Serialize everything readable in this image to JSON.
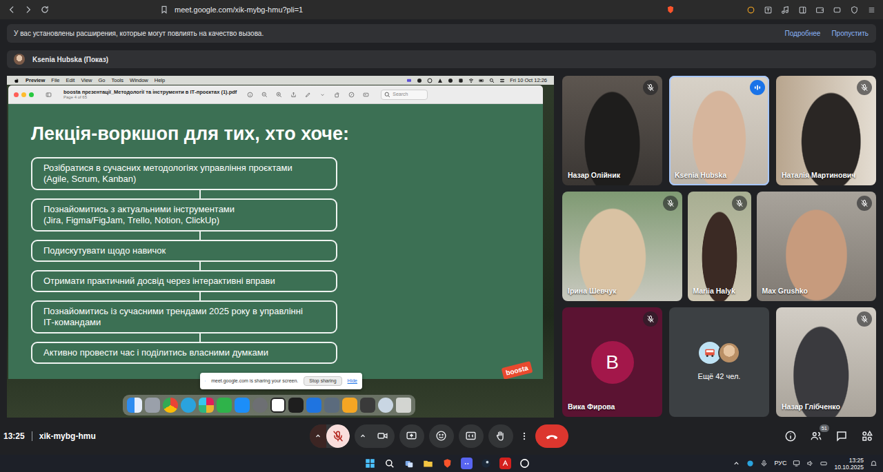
{
  "browser": {
    "url": "meet.google.com/xik-mybg-hmu?pli=1"
  },
  "notice": {
    "text": "У вас установлены расширения, которые могут повлиять на качество вызова.",
    "links": [
      "Подробнее",
      "Пропустить"
    ]
  },
  "presenter": {
    "label": "Ksenia Hubska (Показ)"
  },
  "shared_screen": {
    "menu_bar": {
      "app": "Preview",
      "items": [
        "File",
        "Edit",
        "View",
        "Go",
        "Tools",
        "Window",
        "Help"
      ],
      "clock": "Fri 10 Oct 12:26"
    },
    "preview_window": {
      "title": "boosta презентації_Методології та інструменти в ІТ-проєктах (1).pdf",
      "page": "Page 4 of 65",
      "search_placeholder": "Search"
    },
    "slide": {
      "title": "Лекція-воркшоп для тих, хто хоче:",
      "items": [
        {
          "lines": [
            "Розібратися в сучасних методологіях управління проєктами",
            "(Agile, Scrum, Kanban)"
          ]
        },
        {
          "lines": [
            "Познайомитись з актуальними інструментами",
            "(Jira, Figma/FigJam, Trello, Notion, ClickUp)"
          ]
        },
        {
          "lines": [
            "Подискутувати щодо навичок"
          ]
        },
        {
          "lines": [
            "Отримати практичний досвід через інтерактивні вправи"
          ]
        },
        {
          "lines": [
            "Познайомитись із сучасними трендами 2025 року в управлінні",
            "ІТ-командами"
          ]
        },
        {
          "lines": [
            "Активно провести час і поділитись власними думками"
          ]
        }
      ],
      "logo": "boosta"
    },
    "share_bar": {
      "text": "meet.google.com is sharing your screen.",
      "stop": "Stop sharing",
      "hide": "Hide"
    }
  },
  "participants": [
    {
      "name": "Назар Олійник",
      "kind": "video",
      "muted": true,
      "speaking": false
    },
    {
      "name": "Ksenia Hubska",
      "kind": "video",
      "muted": false,
      "speaking": true
    },
    {
      "name": "Наталія Мартинович",
      "kind": "video",
      "muted": true,
      "speaking": false
    },
    {
      "name": "Ірина Шевчук",
      "kind": "video",
      "muted": true,
      "speaking": false
    },
    {
      "name": "Mariia Halyk",
      "kind": "video",
      "muted": true,
      "speaking": false
    },
    {
      "name": "Max Grushko",
      "kind": "video",
      "muted": true,
      "speaking": false
    },
    {
      "name": "Вика Фирова",
      "kind": "avatar",
      "initial": "В",
      "muted": true,
      "speaking": false
    },
    {
      "name": "Назар Глібченко",
      "kind": "video",
      "muted": true,
      "speaking": false
    }
  ],
  "others": {
    "label": "Ещё 42 чел."
  },
  "bottom_bar": {
    "time": "13:25",
    "meeting_code": "xik-mybg-hmu",
    "mic_muted": true,
    "people_count": "51"
  },
  "taskbar": {
    "language": "РУС",
    "time": "13:25",
    "date": "10.10.2025"
  }
}
